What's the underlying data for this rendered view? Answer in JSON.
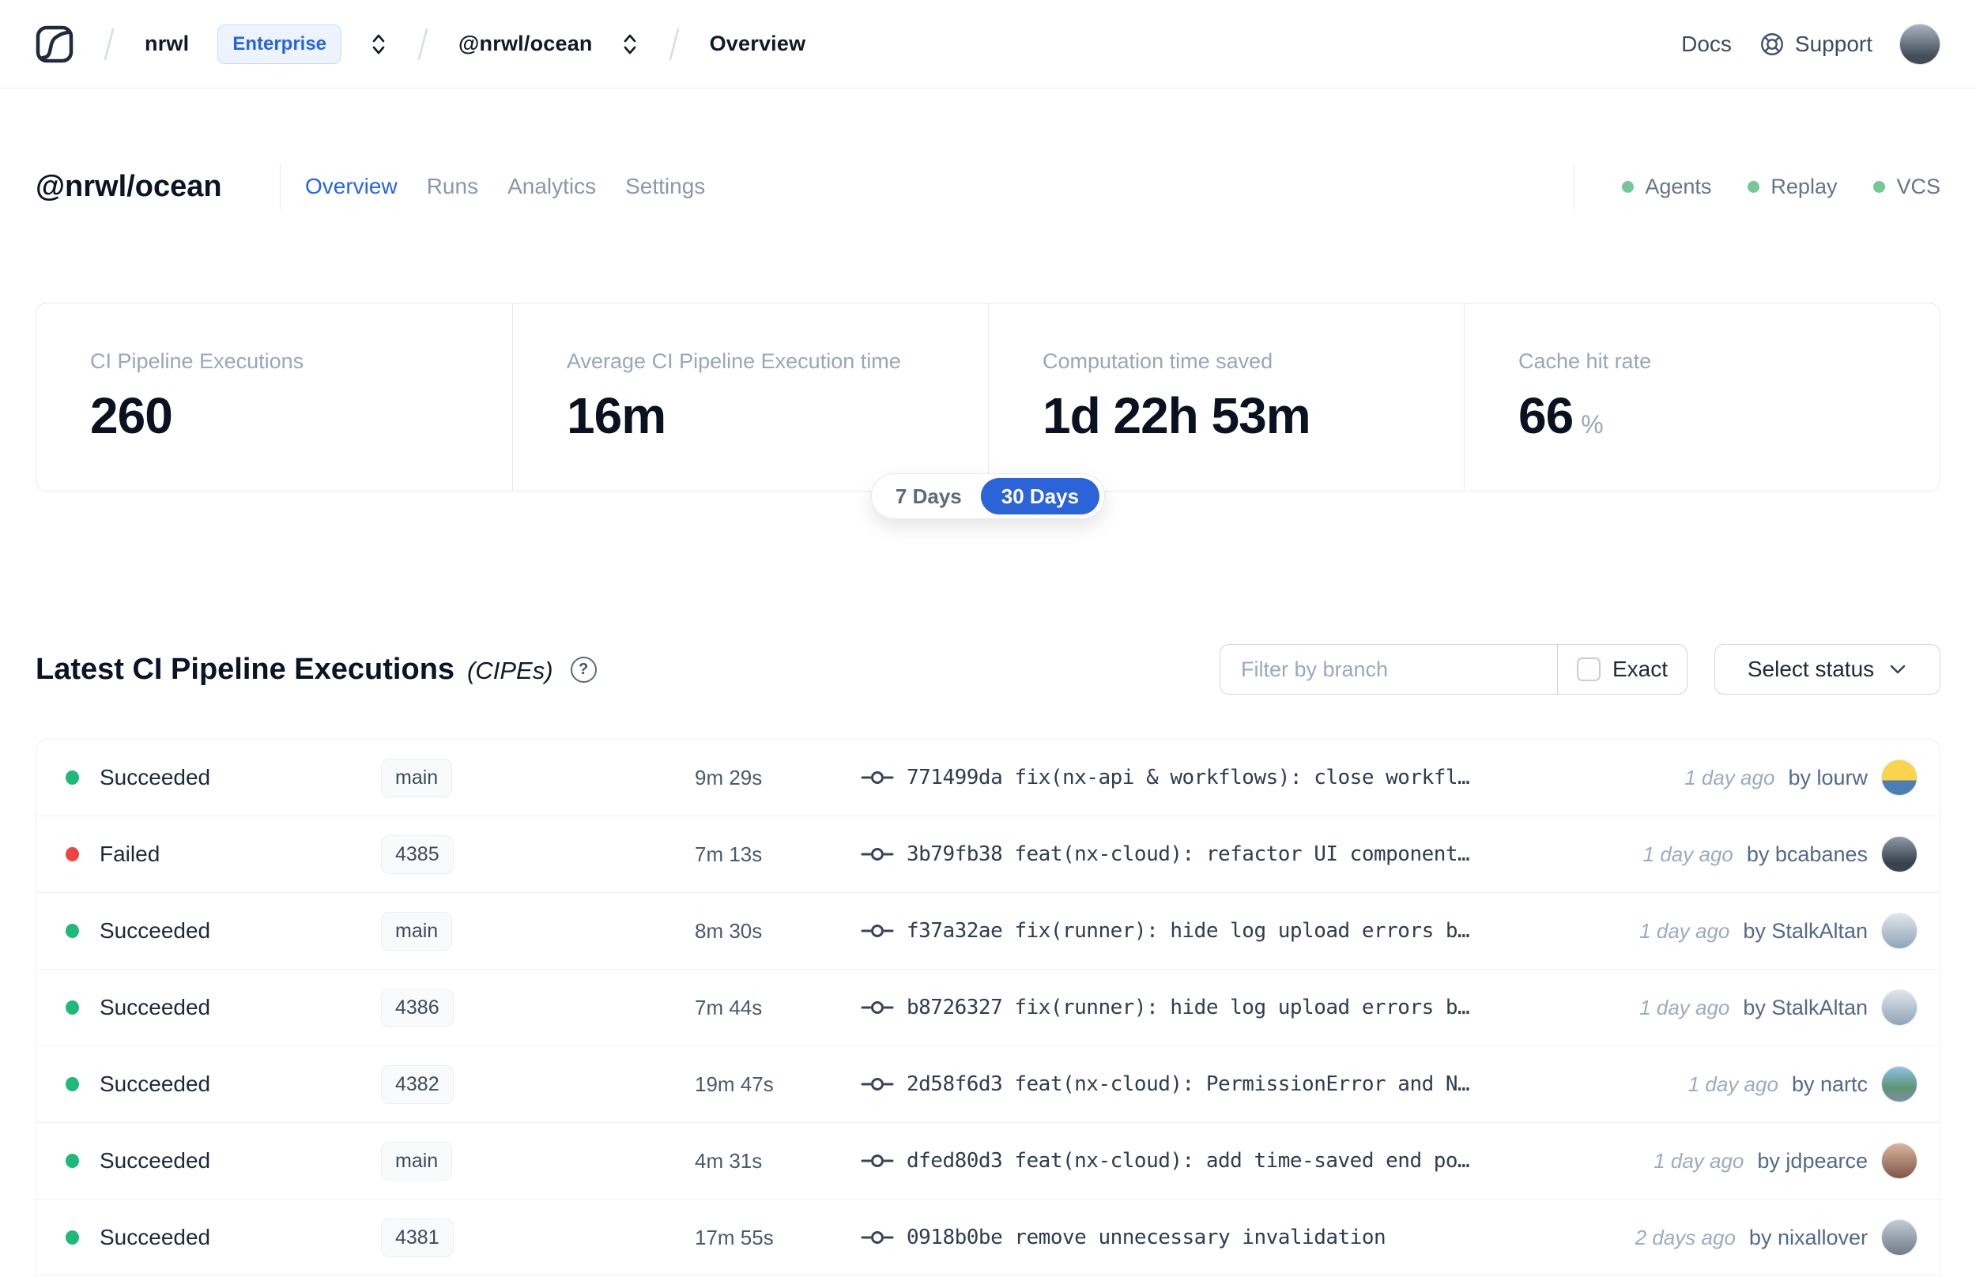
{
  "colors": {
    "accent_blue": "#2563eb",
    "pill_blue": "#2b63d8",
    "success_green": "#1fb97a",
    "failed_red": "#ee4444",
    "indicator_green": "#74c796"
  },
  "navbar": {
    "org": "nrwl",
    "org_badge": "Enterprise",
    "workspace": "@nrwl/ocean",
    "page": "Overview",
    "docs_label": "Docs",
    "support_label": "Support",
    "avatar_style": "background:linear-gradient(180deg,#a7b4bf 0%,#434d58 80%)"
  },
  "header": {
    "title": "@nrwl/ocean",
    "tabs": [
      {
        "label": "Overview"
      },
      {
        "label": "Runs"
      },
      {
        "label": "Analytics"
      },
      {
        "label": "Settings"
      }
    ],
    "indicators": [
      {
        "label": "Agents"
      },
      {
        "label": "Replay"
      },
      {
        "label": "VCS"
      }
    ]
  },
  "stats": {
    "cards": [
      {
        "label": "CI Pipeline Executions",
        "value": "260",
        "suffix": ""
      },
      {
        "label": "Average CI Pipeline Execution time",
        "value": "16m",
        "suffix": ""
      },
      {
        "label": "Computation time saved",
        "value": "1d 22h 53m",
        "suffix": ""
      },
      {
        "label": "Cache hit rate",
        "value": "66",
        "suffix": "%"
      }
    ],
    "range": {
      "option_7": "7 Days",
      "option_30": "30 Days",
      "selected": "30 Days"
    }
  },
  "cipe_section": {
    "title": "Latest CI Pipeline Executions",
    "title_suffix": "(CIPEs)",
    "help_glyph": "?",
    "filter_placeholder": "Filter by branch",
    "exact_label": "Exact",
    "status_dropdown_label": "Select status"
  },
  "table": {
    "rows": [
      {
        "status": "Succeeded",
        "dot_style": "background:#1fb97a",
        "branch": "main",
        "duration": "9m 29s",
        "commit": "771499da fix(nx-api & workflows): close workfl…",
        "time_ago": "1 day ago",
        "author": "by lourw",
        "avatar_style": "background:linear-gradient(180deg,#fcd34d 58%,#4a7fb5 58%)"
      },
      {
        "status": "Failed",
        "dot_style": "background:#ee4444",
        "branch": "4385",
        "duration": "7m 13s",
        "commit": "3b79fb38 feat(nx-cloud): refactor UI component…",
        "time_ago": "1 day ago",
        "author": "by bcabanes",
        "avatar_style": "background:linear-gradient(180deg,#8d9aa8 0%,#39424e 75%)"
      },
      {
        "status": "Succeeded",
        "dot_style": "background:#1fb97a",
        "branch": "main",
        "duration": "8m 30s",
        "commit": "f37a32ae fix(runner): hide log upload errors b…",
        "time_ago": "1 day ago",
        "author": "by StalkAltan",
        "avatar_style": "background:linear-gradient(180deg,#dfe6ec 0%,#90a4b8 100%)"
      },
      {
        "status": "Succeeded",
        "dot_style": "background:#1fb97a",
        "branch": "4386",
        "duration": "7m 44s",
        "commit": "b8726327 fix(runner): hide log upload errors b…",
        "time_ago": "1 day ago",
        "author": "by StalkAltan",
        "avatar_style": "background:linear-gradient(180deg,#dfe6ec 0%,#90a4b8 100%)"
      },
      {
        "status": "Succeeded",
        "dot_style": "background:#1fb97a",
        "branch": "4382",
        "duration": "19m 47s",
        "commit": "2d58f6d3 feat(nx-cloud): PermissionError and N…",
        "time_ago": "1 day ago",
        "author": "by nartc",
        "avatar_style": "background:linear-gradient(180deg,#8cc3e8 0%,#5f9475 60%,#7d8fa0 100%)"
      },
      {
        "status": "Succeeded",
        "dot_style": "background:#1fb97a",
        "branch": "main",
        "duration": "4m 31s",
        "commit": "dfed80d3 feat(nx-cloud): add time-saved end po…",
        "time_ago": "1 day ago",
        "author": "by jdpearce",
        "avatar_style": "background:linear-gradient(180deg,#d9b49c 0%,#80564a 100%)"
      },
      {
        "status": "Succeeded",
        "dot_style": "background:#1fb97a",
        "branch": "4381",
        "duration": "17m 55s",
        "commit": "0918b0be remove unnecessary invalidation",
        "time_ago": "2 days ago",
        "author": "by nixallover",
        "avatar_style": "background:linear-gradient(180deg,#c2cbd4 0%,#707c8a 100%)"
      }
    ]
  }
}
